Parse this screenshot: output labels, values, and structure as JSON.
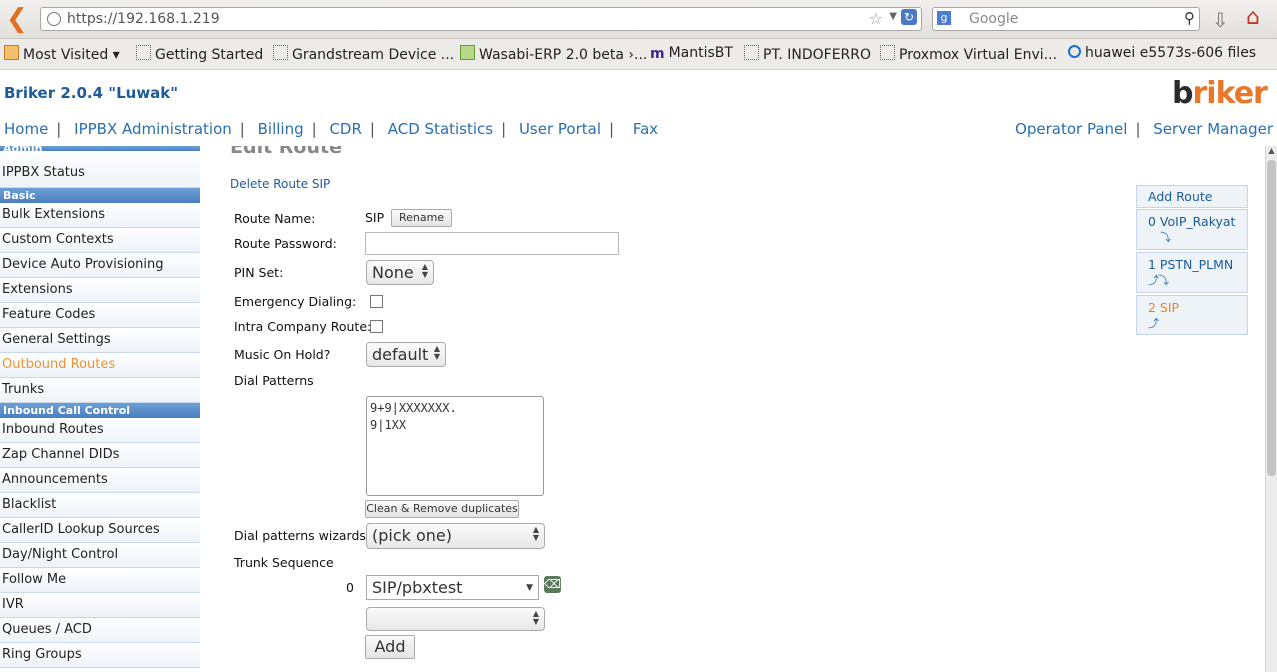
{
  "browser": {
    "url": "https://192.168.1.219",
    "search_placeholder": "Google",
    "bookmarks": [
      "Most Visited ▾",
      "Getting Started",
      "Grandstream Device ...",
      "Wasabi-ERP 2.0 beta ›...",
      "MantisBT",
      "PT. INDOFERRO",
      "Proxmox Virtual Envi...",
      "huawei e5573s-606 files"
    ]
  },
  "app": {
    "title": "Briker 2.0.4 \"Luwak\"",
    "logo_prefix": "b",
    "logo_rest": "riker"
  },
  "topnav": [
    "Home",
    "IPPBX Administration",
    "Billing",
    "CDR",
    "ACD Statistics",
    "User Portal",
    "Fax"
  ],
  "rightnav": [
    "Operator Panel",
    "Server Manager"
  ],
  "sidebar": {
    "admin_header": "Admin",
    "status_item": "IPPBX Status",
    "basic_header": "Basic",
    "basic_items": [
      "Bulk Extensions",
      "Custom Contexts",
      "Device Auto Provisioning",
      "Extensions",
      "Feature Codes",
      "General Settings",
      "Outbound Routes",
      "Trunks"
    ],
    "inbound_header": "Inbound Call Control",
    "inbound_items": [
      "Inbound Routes",
      "Zap Channel DIDs",
      "Announcements",
      "Blacklist",
      "CallerID Lookup Sources",
      "Day/Night Control",
      "Follow Me",
      "IVR",
      "Queues / ACD",
      "Ring Groups"
    ]
  },
  "main": {
    "title": "Edit Route",
    "delete_link": "Delete Route SIP",
    "route_name_label": "Route Name:",
    "route_name_value": "SIP",
    "rename_button": "Rename",
    "route_password_label": "Route Password:",
    "route_password_value": "",
    "pin_set_label": "PIN Set:",
    "pin_set_value": "None",
    "emergency_label": "Emergency Dialing:",
    "intra_label": "Intra Company Route:",
    "moh_label": "Music On Hold?",
    "moh_value": "default",
    "dial_patterns_label": "Dial Patterns",
    "dial_patterns_value": "9+9|XXXXXXX.\n9|1XX",
    "clean_button": "Clean & Remove duplicates",
    "wizard_label": "Dial patterns wizards:",
    "wizard_value": "(pick one)",
    "trunk_seq_label": "Trunk Sequence",
    "trunk_index": "0",
    "trunk_value": "SIP/pbxtest",
    "trunk_empty_value": "",
    "add_button": "Add"
  },
  "routes": {
    "add_label": "Add Route",
    "items": [
      {
        "label": "0 VoIP_Rakyat",
        "arrows": "⤵"
      },
      {
        "label": "1 PSTN_PLMN",
        "arrows": "⤴⤵"
      },
      {
        "label": "2 SIP",
        "arrows": "⤴"
      }
    ]
  },
  "colors": {
    "link": "#2a6fb0",
    "active": "#f0922e",
    "sidebar_header": "#4a7fbf"
  }
}
